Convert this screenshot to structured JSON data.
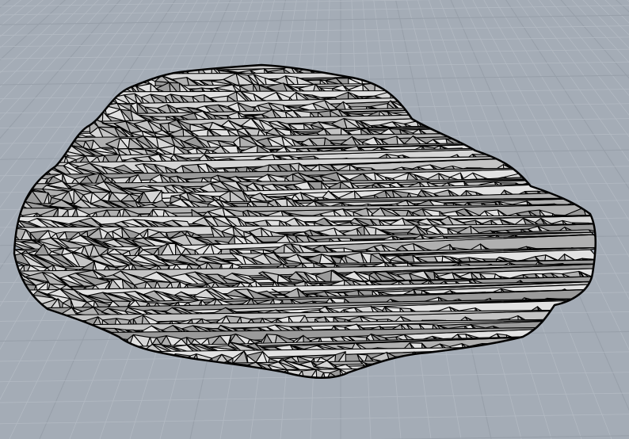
{
  "viewport": {
    "projection": "perspective",
    "background_color": "#a4acb6",
    "grid": {
      "visible": true,
      "minor_line_color": "#b3bac3",
      "major_line_color": "#98a0aa"
    }
  },
  "mesh": {
    "display_mode": "shaded-wireframe",
    "object": "rock",
    "wire_color": "#000000",
    "shade_colors": [
      "#d6d6d6",
      "#c4c4c4",
      "#b0b0b0",
      "#9a9a9a",
      "#e2e2e2"
    ]
  }
}
